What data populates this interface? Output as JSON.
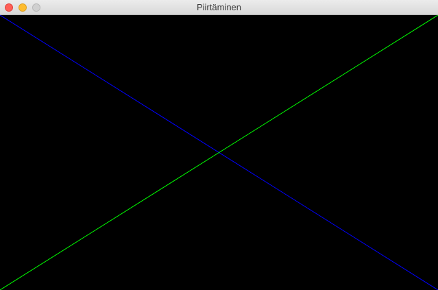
{
  "window": {
    "title": "Piirtäminen"
  },
  "canvas": {
    "background_color": "#000000",
    "lines": [
      {
        "name": "blue-diagonal-line",
        "color": "#0000ff",
        "from": "top-left",
        "to": "bottom-right"
      },
      {
        "name": "green-diagonal-line",
        "color": "#00ff00",
        "from": "bottom-left",
        "to": "top-right"
      }
    ]
  },
  "colors": {
    "close_button": "#ff5f57",
    "minimize_button": "#febc2e",
    "zoom_button": "#d0d0d0",
    "titlebar": "#e4e4e4"
  }
}
